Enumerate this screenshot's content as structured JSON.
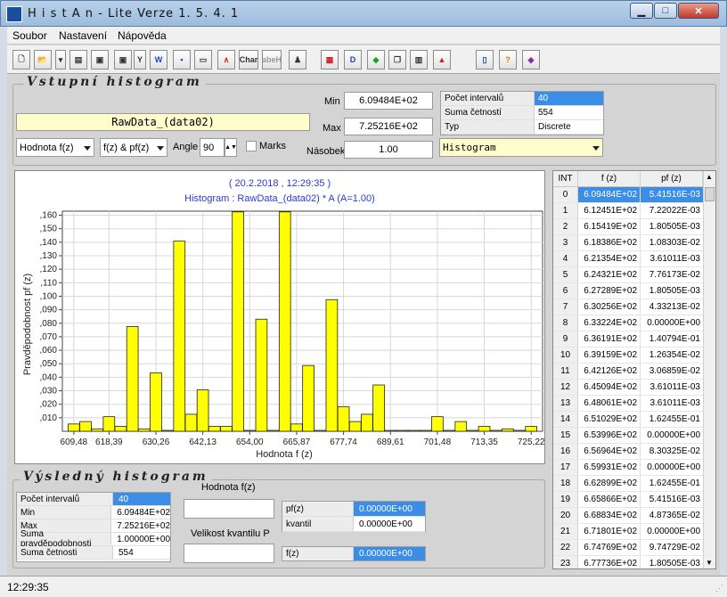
{
  "window": {
    "title": "H i s t A n  -  Lite Verze 1. 5. 4. 1"
  },
  "menu": [
    "Soubor",
    "Nastavení",
    "Nápověda"
  ],
  "toolbar": {
    "char_label": "Char",
    "abeh_label": "abeH",
    "y_label": "Y"
  },
  "input": {
    "section_title": "Vstupní histogram",
    "dataset": "RawData_(data02)",
    "min_label": "Min",
    "min_value": "6.09484E+02",
    "max_label": "Max",
    "max_value": "7.25216E+02",
    "multiplier_label": "Násobek A",
    "multiplier_value": "1.00",
    "value_combo": "Hodnota f(z)",
    "mode_combo": "f(z) & pf(z)",
    "angle_label": "Angle",
    "angle_value": "90",
    "marks_label": "Marks",
    "type_combo": "Histogram",
    "info": [
      {
        "key": "Počet intervalů",
        "value": "40"
      },
      {
        "key": "Suma četností",
        "value": "554"
      },
      {
        "key": "Typ",
        "value": "Discrete"
      }
    ]
  },
  "chart_data": {
    "type": "bar",
    "title": "( 20.2.2018 , 12:29:35 )",
    "subtitle": "Histogram :    RawData_(data02)   * A  (A=1.00)",
    "xlabel": "Hodnota   f (z)",
    "ylabel": "Pravděpodobnost   pf (z)",
    "xlim": [
      606.59,
      728.11
    ],
    "ylim": [
      0,
      0.163
    ],
    "grid": true,
    "x_ticks": [
      "609,48",
      "618,39",
      "630,26",
      "642,13",
      "654,00",
      "665,87",
      "677,74",
      "689,61",
      "701,48",
      "713,35",
      "725,22"
    ],
    "x_tick_values": [
      609.48,
      618.39,
      630.26,
      642.13,
      654.0,
      665.87,
      677.74,
      689.61,
      701.48,
      713.35,
      725.22
    ],
    "y_ticks": [
      ",010",
      ",020",
      ",030",
      ",040",
      ",050",
      ",060",
      ",070",
      ",080",
      ",090",
      ",100",
      ",110",
      ",120",
      ",130",
      ",140",
      ",150",
      ",160"
    ],
    "y_tick_values": [
      0.01,
      0.02,
      0.03,
      0.04,
      0.05,
      0.06,
      0.07,
      0.08,
      0.09,
      0.1,
      0.11,
      0.12,
      0.13,
      0.14,
      0.15,
      0.16
    ],
    "bin_width": 2.8933,
    "x": [
      609.484,
      612.451,
      615.419,
      618.386,
      621.354,
      624.321,
      627.289,
      630.256,
      633.224,
      636.191,
      639.159,
      642.126,
      645.094,
      648.061,
      651.029,
      653.997,
      656.964,
      659.931,
      662.899,
      665.866,
      668.834,
      671.801,
      674.769,
      677.736,
      680.7,
      683.67,
      686.64,
      689.61,
      692.58,
      695.55,
      698.51,
      701.48,
      704.45,
      707.42,
      710.39,
      713.35,
      716.32,
      719.29,
      722.25,
      725.22
    ],
    "values": [
      0.0054,
      0.0072,
      0.0018,
      0.0108,
      0.0036,
      0.0776,
      0.0018,
      0.0433,
      0.0,
      0.1408,
      0.0126,
      0.0307,
      0.0036,
      0.0036,
      0.1625,
      0.0,
      0.083,
      0.0,
      0.1625,
      0.0054,
      0.0487,
      0.0,
      0.0975,
      0.0181,
      0.0072,
      0.0126,
      0.0343,
      0.0,
      0.0,
      0.0,
      0.0,
      0.0108,
      0.0,
      0.0072,
      0.0,
      0.0036,
      0.0,
      0.0018,
      0.0,
      0.0036
    ],
    "color": "#ffff00"
  },
  "table": {
    "headers": [
      "INT",
      "f (z)",
      "pf (z)"
    ],
    "rows": [
      [
        "0",
        "6.09484E+02",
        "5.41516E-03"
      ],
      [
        "1",
        "6.12451E+02",
        "7.22022E-03"
      ],
      [
        "2",
        "6.15419E+02",
        "1.80505E-03"
      ],
      [
        "3",
        "6.18386E+02",
        "1.08303E-02"
      ],
      [
        "4",
        "6.21354E+02",
        "3.61011E-03"
      ],
      [
        "5",
        "6.24321E+02",
        "7.76173E-02"
      ],
      [
        "6",
        "6.27289E+02",
        "1.80505E-03"
      ],
      [
        "7",
        "6.30256E+02",
        "4.33213E-02"
      ],
      [
        "8",
        "6.33224E+02",
        "0.00000E+00"
      ],
      [
        "9",
        "6.36191E+02",
        "1.40794E-01"
      ],
      [
        "10",
        "6.39159E+02",
        "1.26354E-02"
      ],
      [
        "11",
        "6.42126E+02",
        "3.06859E-02"
      ],
      [
        "12",
        "6.45094E+02",
        "3.61011E-03"
      ],
      [
        "13",
        "6.48061E+02",
        "3.61011E-03"
      ],
      [
        "14",
        "6.51029E+02",
        "1.62455E-01"
      ],
      [
        "15",
        "6.53996E+02",
        "0.00000E+00"
      ],
      [
        "16",
        "6.56964E+02",
        "8.30325E-02"
      ],
      [
        "17",
        "6.59931E+02",
        "0.00000E+00"
      ],
      [
        "18",
        "6.62899E+02",
        "1.62455E-01"
      ],
      [
        "19",
        "6.65866E+02",
        "5.41516E-03"
      ],
      [
        "20",
        "6.68834E+02",
        "4.87365E-02"
      ],
      [
        "21",
        "6.71801E+02",
        "0.00000E+00"
      ],
      [
        "22",
        "6.74769E+02",
        "9.74729E-02"
      ],
      [
        "23",
        "6.77736E+02",
        "1.80505E-03"
      ]
    ]
  },
  "output": {
    "section_title": "Výsledný histogram",
    "stats": [
      {
        "key": "Počet intervalů",
        "value": "40"
      },
      {
        "key": "Min",
        "value": "6.09484E+02"
      },
      {
        "key": "Max",
        "value": "7.25216E+02"
      },
      {
        "key": "Suma pravděpodobnosti",
        "value": "1.00000E+00"
      },
      {
        "key": "Suma četnosti",
        "value": "554"
      }
    ],
    "value_label": "Hodnota f(z)",
    "quantile_label": "Velikost kvantilu P",
    "pf_label": "pf(z)",
    "pf_value": "0.00000E+00",
    "kvantil_label": "kvantil",
    "kvantil_value": "0.00000E+00",
    "fz_label": "f(z)",
    "fz_value": "0.00000E+00"
  },
  "status": {
    "time": "12:29:35"
  }
}
